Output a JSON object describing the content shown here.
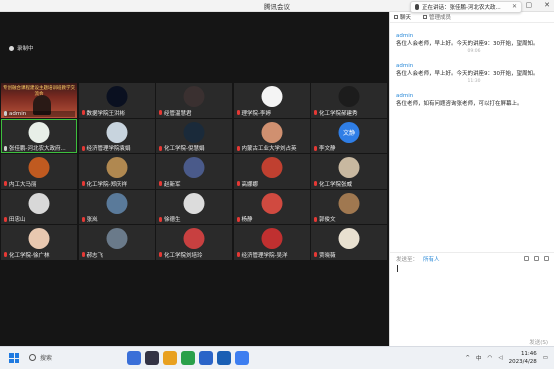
{
  "window": {
    "title": "腾讯会议"
  },
  "recording": {
    "label": "录制中"
  },
  "participants": [
    {
      "name": "admin",
      "video": true,
      "banner": "专创融合课程建设主题培训班教学交流会",
      "mic": "on",
      "color": "#7a2a20"
    },
    {
      "name": "数据学院王洪彬",
      "mic": "off",
      "color": "#0a1020"
    },
    {
      "name": "经管温慧君",
      "mic": "off",
      "color": "#3a3030"
    },
    {
      "name": "理学院-李婷",
      "mic": "off",
      "color": "#f4f4f4"
    },
    {
      "name": "化工学院郝建秀",
      "mic": "off",
      "color": "#1c1c1c"
    },
    {
      "name": "张佳鹏-河北农大政府...",
      "mic": "on",
      "color": "#e8efe8",
      "active": true
    },
    {
      "name": "经济管理学院袁娟",
      "mic": "off",
      "color": "#c8d4de"
    },
    {
      "name": "化工学院-倪慧娟",
      "mic": "off",
      "color": "#1a2a3a"
    },
    {
      "name": "内蒙古工业大学刘占英",
      "mic": "off",
      "color": "#d09070"
    },
    {
      "name": "李文静",
      "mic": "off",
      "color": "#2f7ee6",
      "text": "文静"
    },
    {
      "name": "内工大马丽",
      "mic": "off",
      "color": "#c05a20"
    },
    {
      "name": "化工学院-郑庆祥",
      "mic": "off",
      "color": "#b08850"
    },
    {
      "name": "赵新军",
      "mic": "off",
      "color": "#4a5a8a"
    },
    {
      "name": "高娜娜",
      "mic": "off",
      "color": "#c04030"
    },
    {
      "name": "化工学院张威",
      "mic": "off",
      "color": "#c8b8a0"
    },
    {
      "name": "田忠山",
      "mic": "off",
      "color": "#d8d8d8"
    },
    {
      "name": "张岚",
      "mic": "off",
      "color": "#5a7a9a"
    },
    {
      "name": "徐德生",
      "mic": "off",
      "color": "#dcdcdc"
    },
    {
      "name": "杨静",
      "mic": "off",
      "color": "#d04a40"
    },
    {
      "name": "郭俊文",
      "mic": "off",
      "color": "#a07850"
    },
    {
      "name": "化工学院-徐广林",
      "mic": "off",
      "color": "#e8c8b0"
    },
    {
      "name": "郝志飞",
      "mic": "off",
      "color": "#6a7a8a"
    },
    {
      "name": "化工学院刘培玲",
      "mic": "off",
      "color": "#c84040"
    },
    {
      "name": "经济管理学院-吴洋",
      "mic": "off",
      "color": "#c03030"
    },
    {
      "name": "贾晓薇",
      "mic": "off",
      "color": "#e8e0d0"
    },
    {
      "name": "",
      "empty": true
    },
    {
      "name": "",
      "empty": true
    },
    {
      "name": "",
      "empty": true
    },
    {
      "name": "",
      "empty": true
    },
    {
      "name": "",
      "empty": true
    }
  ],
  "panel": {
    "tabs": [
      {
        "label": "聊天",
        "active": true
      },
      {
        "label": "管理成员",
        "active": false
      }
    ],
    "messages": [
      {
        "sender": "admin",
        "text": "各位人会老师，早上好。今天的讲座9：30开始，望周知。",
        "time": "09:06"
      },
      {
        "sender": "admin",
        "text": "各位人会老师，早上好。今天的讲座9：30开始，望周知。",
        "time": "11:30"
      },
      {
        "sender": "admin",
        "text": "各位老师，如有问题咨询张老师，可以打在屏幕上。",
        "time": ""
      }
    ],
    "send_to_label": "发送至：",
    "send_to_value": "所有人",
    "send_button": "发送(S)"
  },
  "notification": {
    "text": "正在讲话：张佳鹏-河北农大政..."
  },
  "taskbar": {
    "search_label": "搜索",
    "time": "11:46",
    "date": "2023/4/28",
    "lang": "中",
    "apps": [
      {
        "name": "app-1",
        "color": "#3a6fd8"
      },
      {
        "name": "app-2",
        "color": "#333344"
      },
      {
        "name": "app-3",
        "color": "#e8a020"
      },
      {
        "name": "app-4",
        "color": "#2aa04a"
      },
      {
        "name": "app-5",
        "color": "#2a64c8"
      },
      {
        "name": "app-6",
        "color": "#1a5fb4"
      },
      {
        "name": "app-7",
        "color": "#3d7ef0"
      }
    ]
  }
}
